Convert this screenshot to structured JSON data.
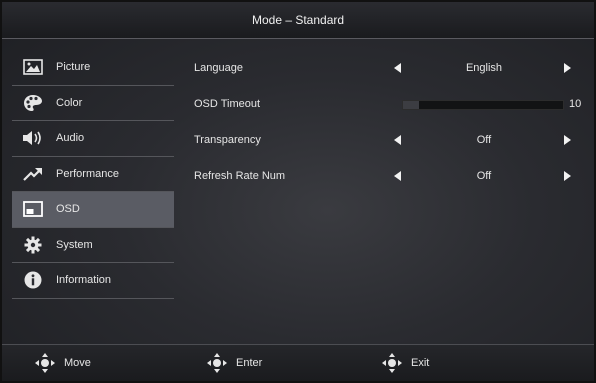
{
  "header": {
    "title": "Mode – Standard"
  },
  "sidebar": {
    "items": [
      {
        "label": "Picture",
        "icon": "picture-icon"
      },
      {
        "label": "Color",
        "icon": "palette-icon"
      },
      {
        "label": "Audio",
        "icon": "speaker-icon"
      },
      {
        "label": "Performance",
        "icon": "trend-arrow-icon"
      },
      {
        "label": "OSD",
        "icon": "osd-window-icon"
      },
      {
        "label": "System",
        "icon": "gear-icon"
      },
      {
        "label": "Information",
        "icon": "info-icon"
      }
    ],
    "active_index": 4
  },
  "settings": {
    "language": {
      "label": "Language",
      "value": "English"
    },
    "osd_timeout": {
      "label": "OSD Timeout",
      "value": "10",
      "level": 0.1
    },
    "transparency": {
      "label": "Transparency",
      "value": "Off"
    },
    "refresh_rate_num": {
      "label": "Refresh Rate Num",
      "value": "Off"
    }
  },
  "footer": {
    "move": {
      "label": "Move",
      "icon": "dpad-icon"
    },
    "enter": {
      "label": "Enter",
      "icon": "dpad-icon"
    },
    "exit": {
      "label": "Exit",
      "icon": "dpad-icon"
    }
  }
}
